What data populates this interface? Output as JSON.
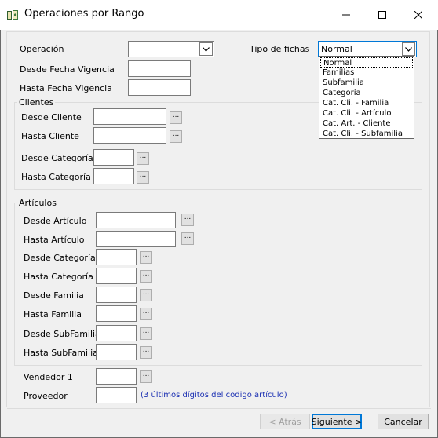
{
  "window": {
    "title": "Operaciones por Rango",
    "icon": "money-icon"
  },
  "form": {
    "operacion_label": "Operación",
    "operacion_value": "",
    "tipo_fichas_label": "Tipo de fichas",
    "tipo_fichas_value": "Normal",
    "tipo_fichas_options": [
      "Normal",
      "Familias",
      "Subfamilia",
      "Categoría",
      "Cat. Cli. - Familia",
      "Cat. Cli. - Artículo",
      "Cat. Art. - Cliente",
      "Cat. Cli. - Subfamilia"
    ],
    "desde_fecha_label": "Desde Fecha Vigencia",
    "hasta_fecha_label": "Hasta Fecha Vigencia"
  },
  "clientes": {
    "title": "Clientes",
    "desde_cliente": "Desde Cliente",
    "hasta_cliente": "Hasta Cliente",
    "desde_categoria": "Desde Categoría",
    "hasta_categoria": "Hasta Categoría"
  },
  "articulos": {
    "title": "Artículos",
    "desde_articulo": "Desde Artículo",
    "hasta_articulo": "Hasta Artículo",
    "desde_categoria": "Desde Categoría",
    "hasta_categoria": "Hasta Categoría",
    "desde_familia": "Desde Familia",
    "hasta_familia": "Hasta Familia",
    "desde_subfamilia": "Desde SubFamilia",
    "hasta_subfamilia": "Hasta SubFamilia"
  },
  "extra": {
    "vendedor_label": "Vendedor 1",
    "proveedor_label": "Proveedor",
    "proveedor_hint": "(3 últimos dígitos del codigo artículo)"
  },
  "ellipsis": "...",
  "buttons": {
    "atras": "< Atrás",
    "siguiente": "Siguiente >",
    "cancelar": "Cancelar"
  },
  "colors": {
    "hint": "#1a2fb2",
    "titlebar": "#ffffff",
    "background": "#f0f0f0"
  }
}
